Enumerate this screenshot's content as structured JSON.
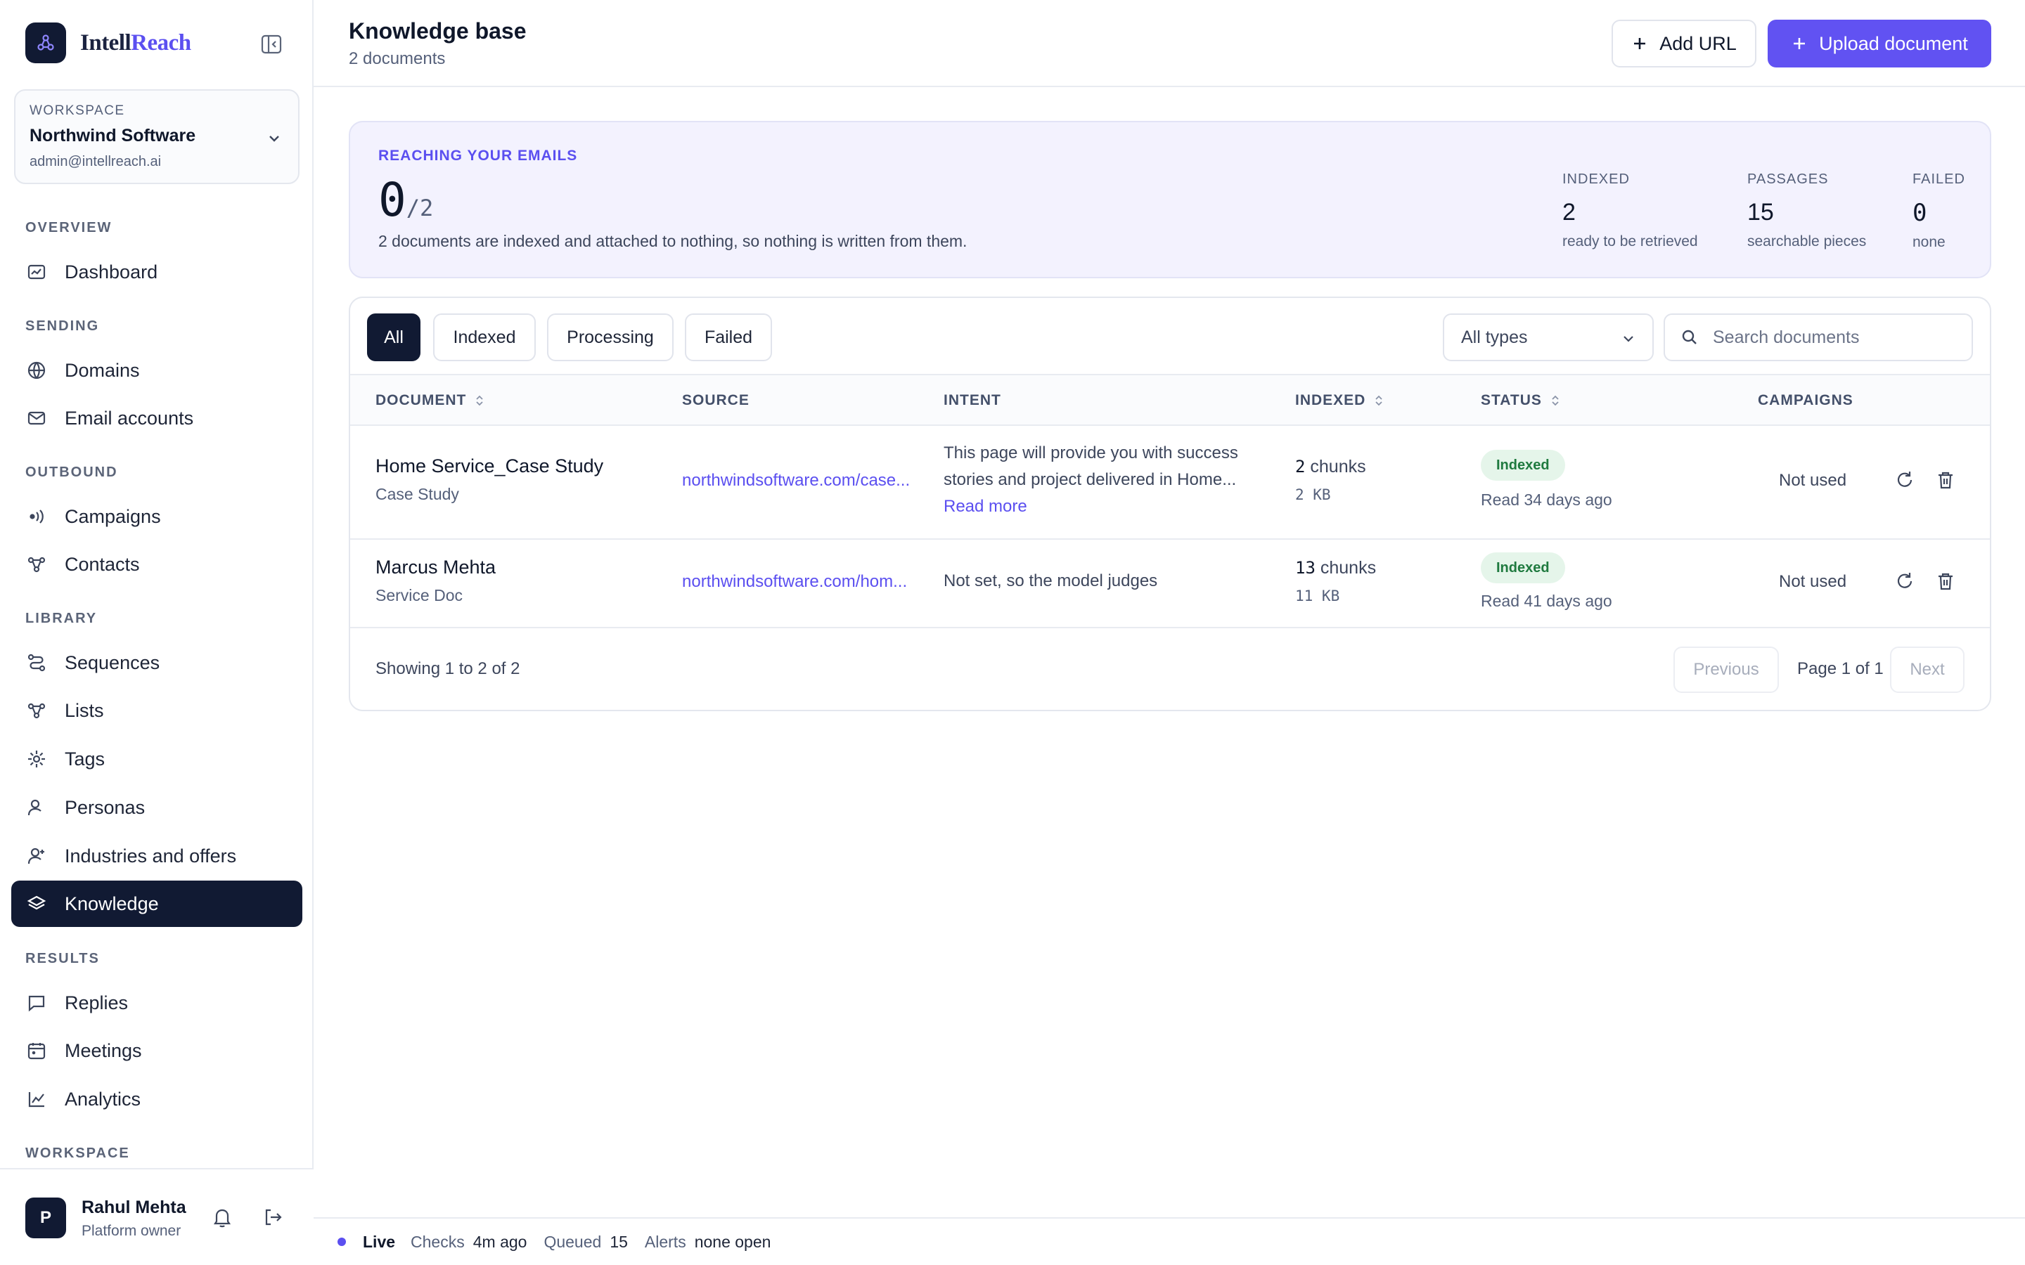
{
  "brand": {
    "name_prefix": "Intell",
    "name_suffix": "Reach"
  },
  "workspace": {
    "label": "WORKSPACE",
    "name": "Northwind Software",
    "email": "admin@intellreach.ai"
  },
  "nav": {
    "overview": {
      "title": "OVERVIEW",
      "items": [
        {
          "label": "Dashboard",
          "icon": "dashboard-icon"
        }
      ]
    },
    "sending": {
      "title": "SENDING",
      "items": [
        {
          "label": "Domains",
          "icon": "globe-icon"
        },
        {
          "label": "Email accounts",
          "icon": "mail-icon"
        }
      ]
    },
    "outbound": {
      "title": "OUTBOUND",
      "items": [
        {
          "label": "Campaigns",
          "icon": "broadcast-icon"
        },
        {
          "label": "Contacts",
          "icon": "network-icon"
        }
      ]
    },
    "library": {
      "title": "LIBRARY",
      "items": [
        {
          "label": "Sequences",
          "icon": "route-icon"
        },
        {
          "label": "Lists",
          "icon": "network-icon"
        },
        {
          "label": "Tags",
          "icon": "sparkle-icon"
        },
        {
          "label": "Personas",
          "icon": "person-icon"
        },
        {
          "label": "Industries and offers",
          "icon": "person-icon"
        },
        {
          "label": "Knowledge",
          "icon": "layers-icon",
          "active": true
        }
      ]
    },
    "results": {
      "title": "RESULTS",
      "items": [
        {
          "label": "Replies",
          "icon": "message-icon"
        },
        {
          "label": "Meetings",
          "icon": "calendar-icon"
        },
        {
          "label": "Analytics",
          "icon": "chart-icon"
        }
      ]
    },
    "workspace": {
      "title": "WORKSPACE"
    }
  },
  "user": {
    "initial": "P",
    "name": "Rahul Mehta",
    "role": "Platform owner"
  },
  "header": {
    "title": "Knowledge base",
    "subtitle": "2 documents",
    "add_url": "Add URL",
    "upload": "Upload document"
  },
  "reach": {
    "label": "REACHING YOUR EMAILS",
    "value": "0",
    "total": "/2",
    "description": "2 documents are indexed and attached to nothing, so nothing is written from them.",
    "stats": [
      {
        "label": "INDEXED",
        "value": "2",
        "note": "ready to be retrieved"
      },
      {
        "label": "PASSAGES",
        "value": "15",
        "note": "searchable pieces"
      },
      {
        "label": "FAILED",
        "value": "0",
        "note": "none"
      }
    ]
  },
  "filters": {
    "tabs": [
      "All",
      "Indexed",
      "Processing",
      "Failed"
    ],
    "active": "All",
    "type_select": "All types",
    "search_placeholder": "Search documents"
  },
  "table": {
    "columns": [
      "DOCUMENT",
      "SOURCE",
      "INTENT",
      "INDEXED",
      "STATUS",
      "CAMPAIGNS"
    ],
    "rows": [
      {
        "title": "Home Service_Case Study",
        "type": "Case Study",
        "source": "northwindsoftware.com/case...",
        "intent": "This page will provide you with success stories and project delivered in Home...",
        "read_more": "Read more",
        "chunks": "2",
        "chunks_label": "chunks",
        "size": "2 KB",
        "status": "Indexed",
        "read_ago": "Read 34 days ago",
        "campaigns": "Not used"
      },
      {
        "title": "Marcus Mehta",
        "type": "Service Doc",
        "source": "northwindsoftware.com/hom...",
        "intent": "Not set, so the model judges",
        "chunks": "13",
        "chunks_label": "chunks",
        "size": "11 KB",
        "status": "Indexed",
        "read_ago": "Read 41 days ago",
        "campaigns": "Not used"
      }
    ],
    "footer": "Showing 1 to 2 of 2",
    "previous": "Previous",
    "page": "Page 1 of 1",
    "next": "Next"
  },
  "statusbar": {
    "live": "Live",
    "checks_label": "Checks",
    "checks_value": "4m ago",
    "queued_label": "Queued",
    "queued_value": "15",
    "alerts_label": "Alerts",
    "alerts_value": "none open"
  },
  "colors": {
    "accent": "#6152f2",
    "navy": "#111a33",
    "success_bg": "#e5f5ea",
    "success_text": "#1f7a3f"
  }
}
